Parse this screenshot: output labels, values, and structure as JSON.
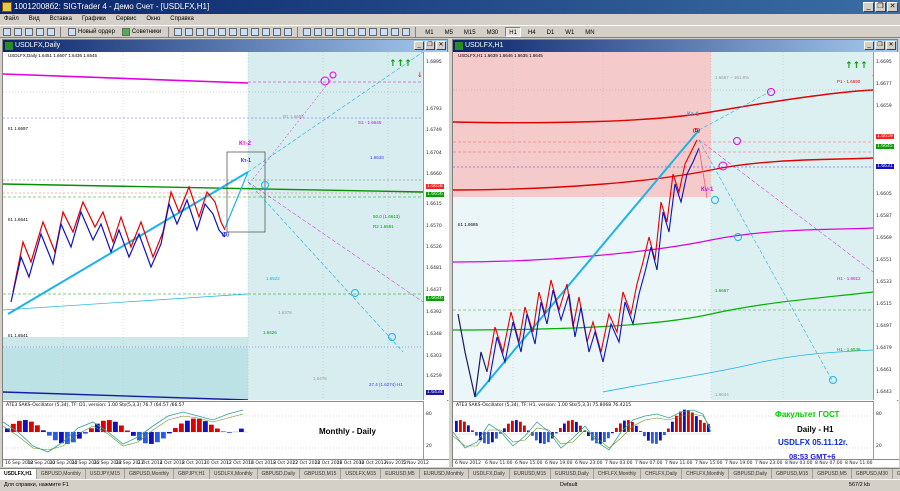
{
  "app": {
    "title": "10012008б2: SIGTrader 4 - Демо Счет - [USDLFX,H1]",
    "window_buttons": [
      "_",
      "❐",
      "✕"
    ]
  },
  "menu": [
    "Файл",
    "Вид",
    "Вставка",
    "Графики",
    "Сервис",
    "Окно",
    "Справка"
  ],
  "toolbar": {
    "new_order": "Новый ордер",
    "experts": "Советники",
    "timeframes": [
      "M1",
      "M5",
      "M15",
      "M30",
      "H1",
      "H4",
      "D1",
      "W1",
      "MN"
    ],
    "active_timeframe": "H1"
  },
  "left_chart": {
    "title": "USDLFX,Daily",
    "info": "USDLFX,Daily 1.6451 1.6607 1.6436 1.6545",
    "scale": [
      "1.6895",
      "1.6793",
      "1.6749",
      "1.6704",
      "1.6660",
      "1.6615",
      "1.6570",
      "1.6526",
      "1.6481",
      "1.6437",
      "1.6392",
      "1.6348",
      "1.6303",
      "1.6259",
      "1.6214"
    ],
    "price_tags": [
      "1.6658",
      "1.6656",
      "1.6646",
      "1.6663",
      "1.6628",
      "1.6434"
    ],
    "labels": {
      "kt2": "Кт-2",
      "kt1": "Кт-1",
      "b": "(В)",
      "s1": "S1 - 1.6646",
      "r1_upper": "R1 1.6695",
      "lvl_1": "1.6633",
      "lvl_2": "1.6522",
      "lvl_3": "1.6478",
      "lvl_4": "1.6426",
      "lvl_5": "1.6378",
      "s2_mid": "50.0 (1.6613)",
      "s3_low": "27.4 (1.6274) H1",
      "lvl_r": "R2 1.6591",
      "ii1": "II1 1.6697",
      "ii2": "II1 1.6641",
      "ii3": "II1 1.6541",
      "ii4": "II1 1.6321"
    },
    "dates": [
      "16 Sep 2012",
      "18 Sep 2012",
      "20 Sep 2012",
      "24 Sep 2012",
      "26 Sep 2012",
      "28 Sep 2012",
      "2 Oct 2012",
      "4 Oct 2012",
      "8 Oct 2012",
      "10 Oct 2012",
      "12 Oct 2012",
      "16 Oct 2012",
      "18 Oct 2012",
      "22 Oct 2012",
      "24 Oct 2012",
      "26 Oct 2012",
      "30 Oct 2012",
      "1 Nov 2012",
      "5 Nov 2012"
    ],
    "osc": {
      "label": "ATE3 SAKS-Oscillator (5,34), TF: D1, version: 1.00  Sts(5,3,3) 76.7 (64.57 /66.57",
      "caption": "Monthly - Daily",
      "levels": [
        "80",
        "20"
      ]
    }
  },
  "right_chart": {
    "title": "USDLFX,H1",
    "info": "USDLFX,H1 1.6639 1.6646 1.6635 1.6645",
    "scale": [
      "1.6695",
      "1.6677",
      "1.6659",
      "1.6641",
      "1.6623",
      "1.6605",
      "1.6587",
      "1.6569",
      "1.6551",
      "1.6533",
      "1.6515",
      "1.6497",
      "1.6479",
      "1.6461",
      "1.6443"
    ],
    "price_tags": [
      "1.6659",
      "1.6645",
      "1.6631",
      "1.6628"
    ],
    "labels": {
      "kt1": "Кт-1",
      "kv1": "Кv-1",
      "b": "(В)",
      "p1": "P1 - 1.6690",
      "h1_mid": "H1 - 1.6612",
      "h1_low": "H1 - 1.6536",
      "lvl_h": "H1 - 1.6482",
      "p2": "1.6667",
      "p3": "1.6644",
      "p4": "1.6523",
      "fib_top": "1.6667 ~ 161.8%",
      "ii1": "II1 1.6685"
    },
    "dates": [
      "6 Nov 2012",
      "6 Nov 11:00",
      "6 Nov 15:00",
      "6 Nov 19:00",
      "6 Nov 23:00",
      "7 Nov 03:00",
      "7 Nov 07:00",
      "7 Nov 11:00",
      "7 Nov 15:00",
      "7 Nov 19:00",
      "7 Nov 23:00",
      "8 Nov 03:00",
      "8 Nov 07:00",
      "8 Nov 11:00"
    ],
    "osc": {
      "label": "ATE3 SAKS-Oscillator (5,34), TF: H1, version: 1.00  Sts(5,3,3) 75.8068 76.4215",
      "levels": [
        "80",
        "20"
      ]
    }
  },
  "overlay_text": {
    "faculty": "Факультет ГОСТ",
    "timeframes": "Daily - H1",
    "date": "USDLFX 05.11.12г.",
    "time": "08:53  GMT+6"
  },
  "tabs": [
    "USDLFX,H1",
    "GBPUSD,Monthly",
    "USDJPY,M15",
    "GBPUSD,Monthly",
    "GBPJPY,H1",
    "USDLFX,Monthly",
    "GBPUSD,Daily",
    "GBPUSD,M15",
    "USDLFX,M15",
    "EURUSD,M5",
    "EURUSD,Monthly",
    "USDLFX,Daily",
    "EURUSD,M15",
    "EURUSD,Daily",
    "CHFLFX,Monthly",
    "CHFLFX,Daily",
    "CHFLFX,Monthly",
    "GBPUSD,Daily",
    "GBPUSD,M15",
    "GBPUSD,M5",
    "GBPUSD,M30",
    "GBPUSD,M5"
  ],
  "active_tab": "USDLFX,H1",
  "status": {
    "left": "Для справки, нажмите F1",
    "mid": "Default",
    "right": "567/2 kb"
  },
  "colors": {
    "bg_left_top": "#f4c4c4",
    "bg_teal": "#c6e6e8",
    "bull": "#ff0000",
    "bear": "#0000cc",
    "trend": "#1fb2e8",
    "magenta": "#e000e0",
    "green": "#00b000",
    "green_text": "#00cc00",
    "navy_text": "#1c1ce0",
    "blue_text": "#0b2bd8"
  }
}
